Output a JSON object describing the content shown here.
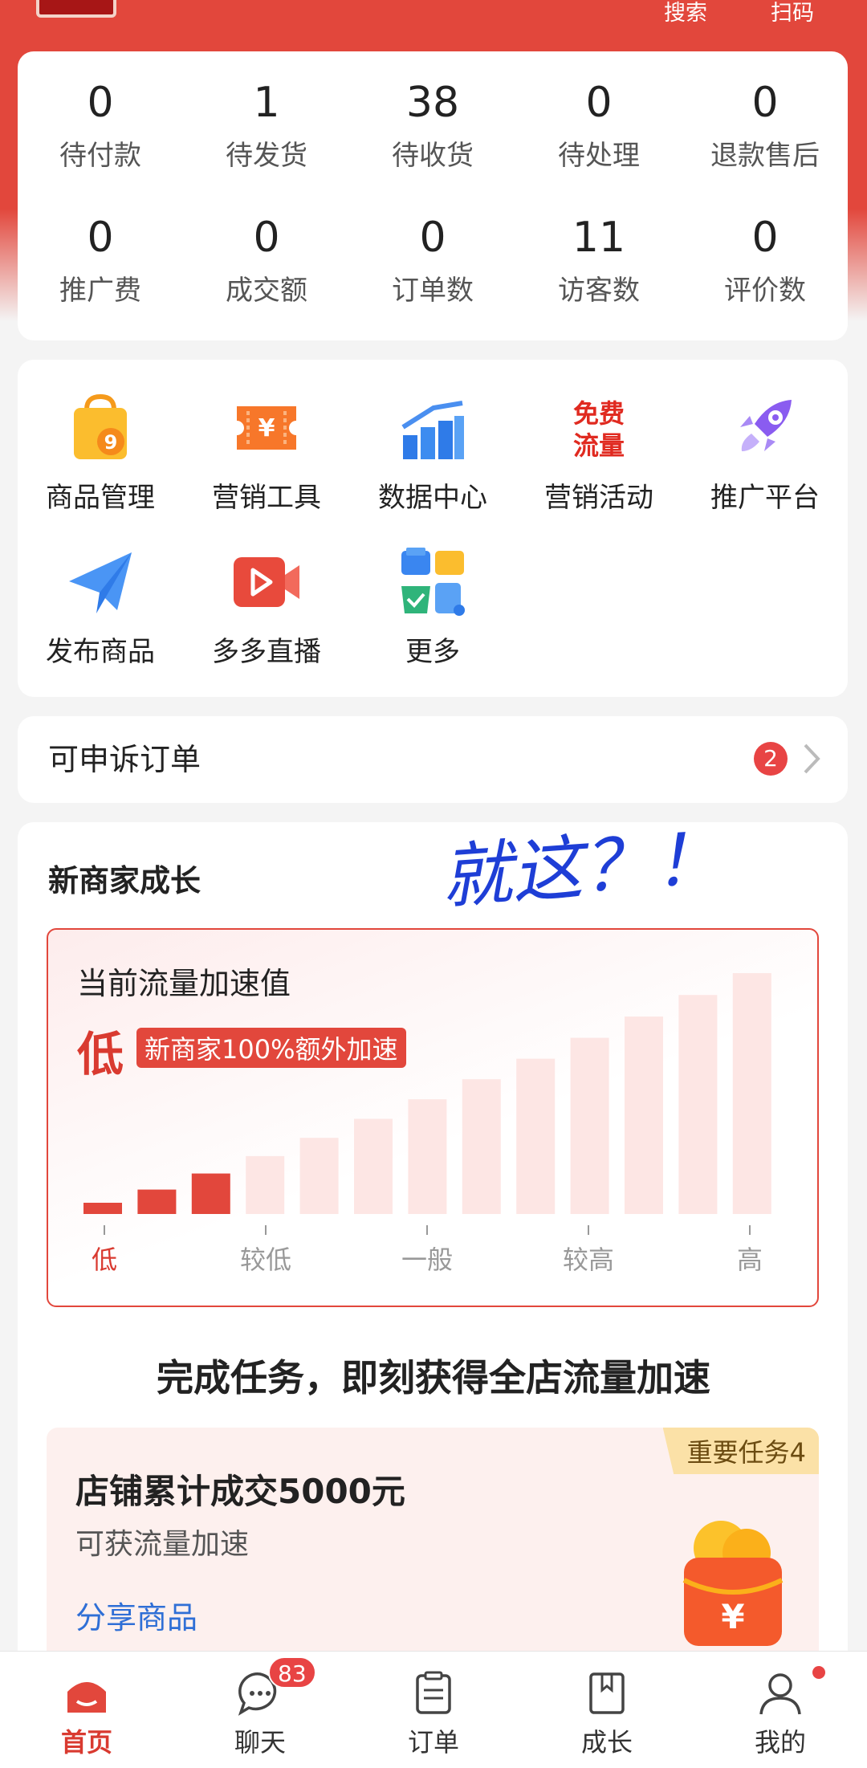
{
  "topbar": {
    "search_label": "搜索",
    "scan_label": "扫码"
  },
  "stats": [
    {
      "value": "0",
      "label": "待付款"
    },
    {
      "value": "1",
      "label": "待发货"
    },
    {
      "value": "38",
      "label": "待收货"
    },
    {
      "value": "0",
      "label": "待处理"
    },
    {
      "value": "0",
      "label": "退款售后"
    },
    {
      "value": "0",
      "label": "推广费"
    },
    {
      "value": "0",
      "label": "成交额"
    },
    {
      "value": "0",
      "label": "订单数"
    },
    {
      "value": "11",
      "label": "访客数"
    },
    {
      "value": "0",
      "label": "评价数"
    }
  ],
  "tools": [
    {
      "label": "商品管理",
      "icon": "shopping-bag-icon"
    },
    {
      "label": "营销工具",
      "icon": "coupon-icon"
    },
    {
      "label": "数据中心",
      "icon": "bar-chart-icon"
    },
    {
      "label": "营销活动",
      "icon": "free-traffic-icon",
      "icon_text": [
        "免费",
        "流量"
      ]
    },
    {
      "label": "推广平台",
      "icon": "rocket-icon"
    },
    {
      "label": "发布商品",
      "icon": "paper-plane-icon"
    },
    {
      "label": "多多直播",
      "icon": "video-icon"
    },
    {
      "label": "更多",
      "icon": "more-grid-icon"
    }
  ],
  "appeal": {
    "title": "可申诉订单",
    "badge": "2"
  },
  "growth": {
    "title": "新商家成长",
    "handwriting": "就这？！",
    "meter": {
      "title": "当前流量加速值",
      "level": "低",
      "tag": "新商家100%额外加速",
      "ticks": [
        "低",
        "较低",
        "一般",
        "较高",
        "高"
      ],
      "bars_total": 13,
      "bars_filled": 3
    },
    "task_heading": "完成任务，即刻获得全店流量加速",
    "task": {
      "ribbon": "重要任务4",
      "title": "店铺累计成交5000元",
      "subtitle": "可获流量加速",
      "action": "分享商品"
    }
  },
  "nav": [
    {
      "label": "首页",
      "icon": "home-icon",
      "active": true
    },
    {
      "label": "聊天",
      "icon": "chat-icon",
      "badge": "83"
    },
    {
      "label": "订单",
      "icon": "order-icon"
    },
    {
      "label": "成长",
      "icon": "growth-book-icon"
    },
    {
      "label": "我的",
      "icon": "user-icon",
      "dot": true
    }
  ],
  "colors": {
    "brand_red": "#e2473c",
    "link_blue": "#2f6fd6",
    "badge_red": "#e84444"
  }
}
